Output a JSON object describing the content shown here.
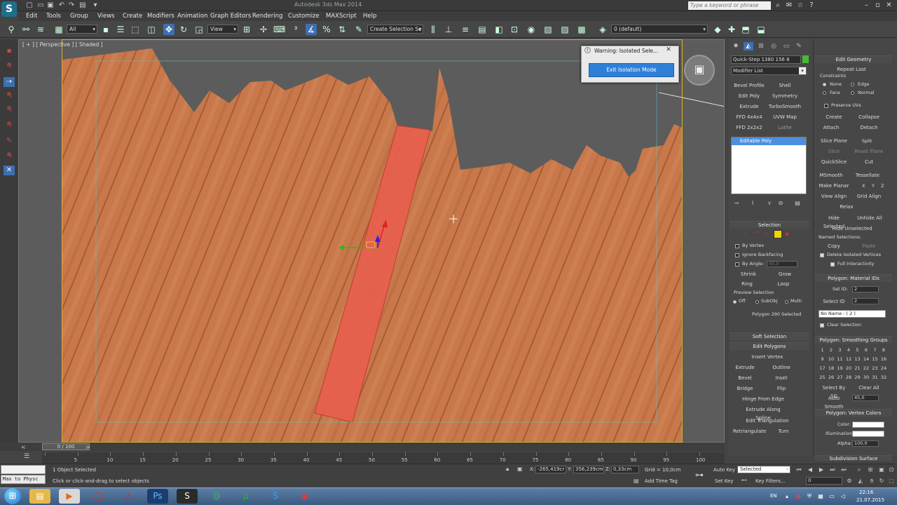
{
  "window": {
    "title": "Autodesk 3ds Max 2014",
    "search_placeholder": "Type a keyword or phrase"
  },
  "menu": [
    "Edit",
    "Tools",
    "Group",
    "Views",
    "Create",
    "Modifiers",
    "Animation",
    "Graph Editors",
    "Rendering",
    "Customize",
    "MAXScript",
    "Help"
  ],
  "toolbar": {
    "selection_filter": "All",
    "ref_coord": "View",
    "named_selection": "Create Selection Se",
    "layer": "0 (default)"
  },
  "viewport": {
    "label": "[ + ] [ Perspective ] [ Shaded ]",
    "floor_color": "#c8784a",
    "selection_color": "#e8604f",
    "bounds_color": "#d8b030"
  },
  "warning": {
    "title": "Warning: Isolated Sele...",
    "button": "Exit Isolation Mode"
  },
  "command_panel": {
    "object_name": "Quick-Step 1380 156 8",
    "modifier_list": "Modifier List",
    "buttons": [
      "Bevel Profile",
      "Shell",
      "Edit Poly",
      "Symmetry",
      "Extrude",
      "TurboSmooth",
      "FFD 4x4x4",
      "UVW Map",
      "FFD 2x2x2",
      "Lathe"
    ],
    "stack_item": "Editable Poly",
    "selection_rollout": "Selection",
    "by_vertex": "By Vertex",
    "ignore_backfacing": "Ignore Backfacing",
    "by_angle": "By Angle:",
    "angle_value": "45,0",
    "shrink": "Shrink",
    "grow": "Grow",
    "ring": "Ring",
    "loop": "Loop",
    "preview_selection": "Preview Selection",
    "preview_off": "Off",
    "preview_subobj": "SubObj",
    "preview_multi": "Multi",
    "selected_info": "Polygon 290 Selected",
    "soft_selection": "Soft Selection",
    "edit_polygons": "Edit Polygons",
    "insert_vertex": "Insert Vertex",
    "extrude": "Extrude",
    "outline": "Outline",
    "bevel": "Bevel",
    "inset": "Inset",
    "bridge": "Bridge",
    "flip": "Flip",
    "hinge": "Hinge From Edge",
    "extrude_spline": "Extrude Along Spline",
    "edit_triangulation": "Edit Triangulation",
    "retriangulate": "Retriangulate",
    "turn": "Turn"
  },
  "right_panel": {
    "edit_geometry": "Edit Geometry",
    "repeat_last": "Repeat Last",
    "constraints": "Constraints",
    "c_none": "None",
    "c_edge": "Edge",
    "c_face": "Face",
    "c_normal": "Normal",
    "preserve_uvs": "Preserve UVs",
    "create": "Create",
    "collapse": "Collapse",
    "attach": "Attach",
    "detach": "Detach",
    "slice_plane": "Slice Plane",
    "split": "Split",
    "slice": "Slice",
    "reset_plane": "Reset Plane",
    "quickslice": "QuickSlice",
    "cut": "Cut",
    "msmooth": "MSmooth",
    "tessellate": "Tessellate",
    "make_planar": "Make Planar",
    "x": "X",
    "y": "Y",
    "z": "Z",
    "view_align": "View Align",
    "grid_align": "Grid Align",
    "relax": "Relax",
    "hide_selected": "Hide Selected",
    "unhide_all": "Unhide All",
    "hide_unselected": "Hide Unselected",
    "named_selections": "Named Selections:",
    "copy": "Copy",
    "paste": "Paste",
    "delete_isolated": "Delete Isolated Vertices",
    "full_interactivity": "Full Interactivity",
    "material_ids": "Polygon: Material IDs",
    "set_id": "Set ID:",
    "set_id_val": "2",
    "select_id": "Select ID",
    "select_id_val": "2",
    "material_name": "No Name - ( 2 )",
    "clear_selection": "Clear Selection",
    "smoothing_groups": "Polygon: Smoothing Groups",
    "sg_numbers": [
      "1",
      "2",
      "3",
      "4",
      "5",
      "6",
      "7",
      "8",
      "9",
      "10",
      "11",
      "12",
      "13",
      "14",
      "15",
      "16",
      "17",
      "18",
      "19",
      "20",
      "21",
      "22",
      "23",
      "24",
      "25",
      "26",
      "27",
      "28",
      "29",
      "30",
      "31",
      "32"
    ],
    "select_by_sg": "Select By SG",
    "clear_all": "Clear All",
    "auto_smooth": "Auto Smooth",
    "auto_smooth_val": "45,0",
    "vertex_colors": "Polygon: Vertex Colors",
    "color": "Color:",
    "illumination": "Illumination:",
    "alpha": "Alpha:",
    "alpha_val": "100,0",
    "subdivision_surface": "Subdivision Surface"
  },
  "timeline": {
    "slider": "0 / 100",
    "ticks": [
      "0",
      "5",
      "10",
      "15",
      "20",
      "25",
      "30",
      "35",
      "40",
      "45",
      "50",
      "55",
      "60",
      "65",
      "70",
      "75",
      "80",
      "85",
      "90",
      "95",
      "100"
    ]
  },
  "status": {
    "maxscript_text": "Max to Physc",
    "objects_selected": "1 Object Selected",
    "prompt": "Click or click-and-drag to select objects",
    "x_label": "X:",
    "x_val": "-265,419cr",
    "y_label": "Y:",
    "y_val": "356,239cm",
    "z_label": "Z:",
    "z_val": "0,33cm",
    "grid": "Grid = 10,0cm",
    "add_time_tag": "Add Time Tag",
    "auto_key": "Auto Key",
    "set_key": "Set Key",
    "key_mode": "Selected",
    "key_filters": "Key Filters...",
    "frame": "0"
  },
  "taskbar": {
    "lang": "EN",
    "time": "22:16",
    "date": "21.07.2015"
  }
}
